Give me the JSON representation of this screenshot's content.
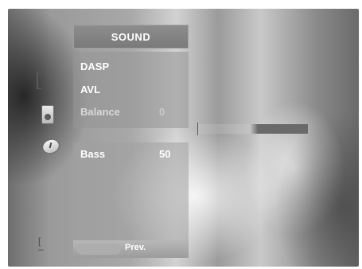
{
  "menu": {
    "title": "SOUND",
    "items": [
      {
        "label": "DASP",
        "value": ""
      },
      {
        "label": "AVL",
        "value": ""
      },
      {
        "label": "Balance",
        "value": "0"
      }
    ]
  },
  "submenu": {
    "items": [
      {
        "label": "Bass",
        "value": "50"
      }
    ]
  },
  "balance_level": 0,
  "bottom_bar": {
    "prev_label": "Prev."
  },
  "sidebar_icons": [
    "bracket-icon",
    "speaker-icon",
    "clock-icon",
    "link-icon"
  ],
  "colors": {
    "title_bg": "#7f7f7f",
    "text": "#ffffff"
  }
}
